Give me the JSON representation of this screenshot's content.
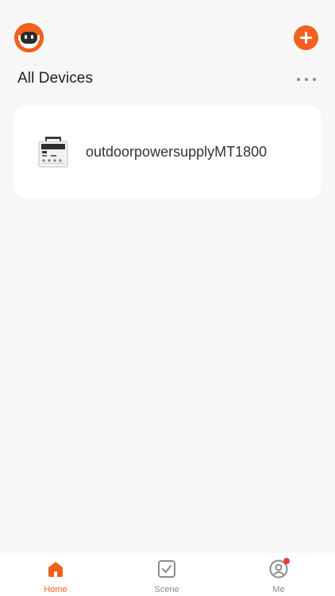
{
  "header": {
    "avatar_icon": "robot-avatar-icon",
    "add_icon": "plus-icon"
  },
  "section": {
    "title": "All Devices",
    "more_icon": "more-horizontal-icon"
  },
  "devices": [
    {
      "name": "outdoorpowersupplyMT1800",
      "icon": "power-station-icon"
    }
  ],
  "tabbar": {
    "tabs": [
      {
        "label": "Home",
        "icon": "home-icon",
        "active": true
      },
      {
        "label": "Scene",
        "icon": "scene-checkbox-icon",
        "active": false
      },
      {
        "label": "Me",
        "icon": "user-icon",
        "active": false,
        "badge": true
      }
    ]
  },
  "colors": {
    "accent": "#f2601e",
    "background": "#f7f7f7",
    "card": "#ffffff",
    "badge": "#f23c3c"
  }
}
